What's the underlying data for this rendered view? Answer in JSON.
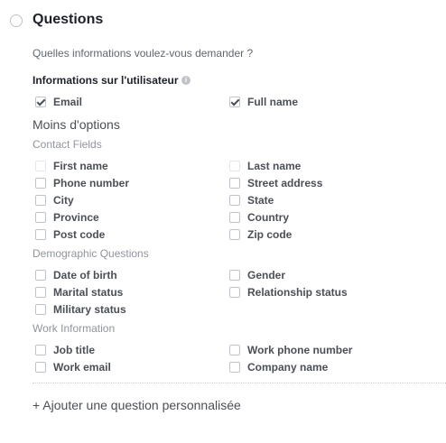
{
  "section": {
    "title": "Questions",
    "prompt": "Quelles informations voulez-vous demander ?"
  },
  "user_info": {
    "heading": "Informations sur l'utilisateur",
    "info_icon": "info-icon",
    "fields": [
      {
        "label": "Email",
        "checked": true
      },
      {
        "label": "Full name",
        "checked": true
      }
    ]
  },
  "less_options": "Moins d'options",
  "contact_fields": {
    "heading": "Contact Fields",
    "fields": [
      {
        "label": "First name",
        "checked": false,
        "disabled": true
      },
      {
        "label": "Last name",
        "checked": false,
        "disabled": true
      },
      {
        "label": "Phone number",
        "checked": false
      },
      {
        "label": "Street address",
        "checked": false
      },
      {
        "label": "City",
        "checked": false
      },
      {
        "label": "State",
        "checked": false
      },
      {
        "label": "Province",
        "checked": false
      },
      {
        "label": "Country",
        "checked": false
      },
      {
        "label": "Post code",
        "checked": false
      },
      {
        "label": "Zip code",
        "checked": false
      }
    ]
  },
  "demographic_questions": {
    "heading": "Demographic Questions",
    "fields": [
      {
        "label": "Date of birth",
        "checked": false
      },
      {
        "label": "Gender",
        "checked": false
      },
      {
        "label": "Marital status",
        "checked": false
      },
      {
        "label": "Relationship status",
        "checked": false
      },
      {
        "label": "Military status",
        "checked": false
      }
    ]
  },
  "work_information": {
    "heading": "Work Information",
    "fields": [
      {
        "label": "Job title",
        "checked": false
      },
      {
        "label": "Work phone number",
        "checked": false
      },
      {
        "label": "Work email",
        "checked": false
      },
      {
        "label": "Company name",
        "checked": false
      }
    ]
  },
  "add_question": "+ Ajouter une question personnalisée"
}
